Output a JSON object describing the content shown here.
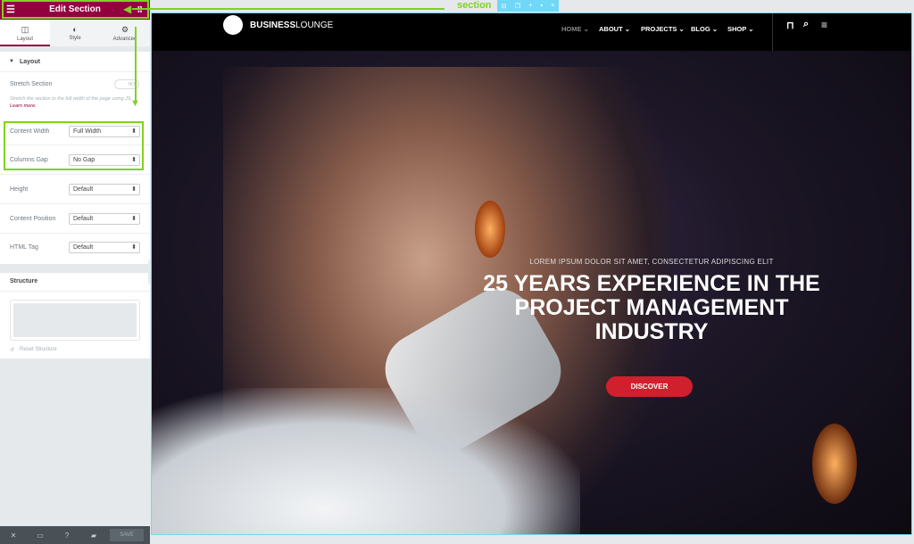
{
  "panel": {
    "title": "Edit Section",
    "tabs": [
      "Layout",
      "Style",
      "Advanced"
    ],
    "section_heading": "Layout",
    "stretch_label": "Stretch Section",
    "stretch_toggle": "NO",
    "stretch_desc": "Stretch the section to the full width of the page using JS.",
    "learn_more": "Learn more.",
    "controls": [
      {
        "label": "Content Width",
        "value": "Full Width"
      },
      {
        "label": "Columns Gap",
        "value": "No Gap"
      },
      {
        "label": "Height",
        "value": "Default"
      },
      {
        "label": "Content Position",
        "value": "Default"
      },
      {
        "label": "HTML Tag",
        "value": "Default"
      }
    ],
    "structure_heading": "Structure",
    "reset_structure": "Reset Structure",
    "save": "SAVE"
  },
  "annotation": {
    "label": "section",
    "color": "#7ed321"
  },
  "site": {
    "logo_bold": "BUSINESS",
    "logo_light": "LOUNGE",
    "nav": [
      "HOME",
      "ABOUT",
      "PROJECTS",
      "BLOG",
      "SHOP"
    ],
    "hero_sub": "LOREM IPSUM DOLOR SIT AMET, CONSECTETUR ADIPISCING ELIT",
    "hero_title": "25 YEARS EXPERIENCE IN THE PROJECT MANAGEMENT INDUSTRY",
    "button": "DISCOVER"
  },
  "colors": {
    "brand": "#93003f",
    "accent": "#d0202e",
    "selection": "#71d7f7"
  }
}
